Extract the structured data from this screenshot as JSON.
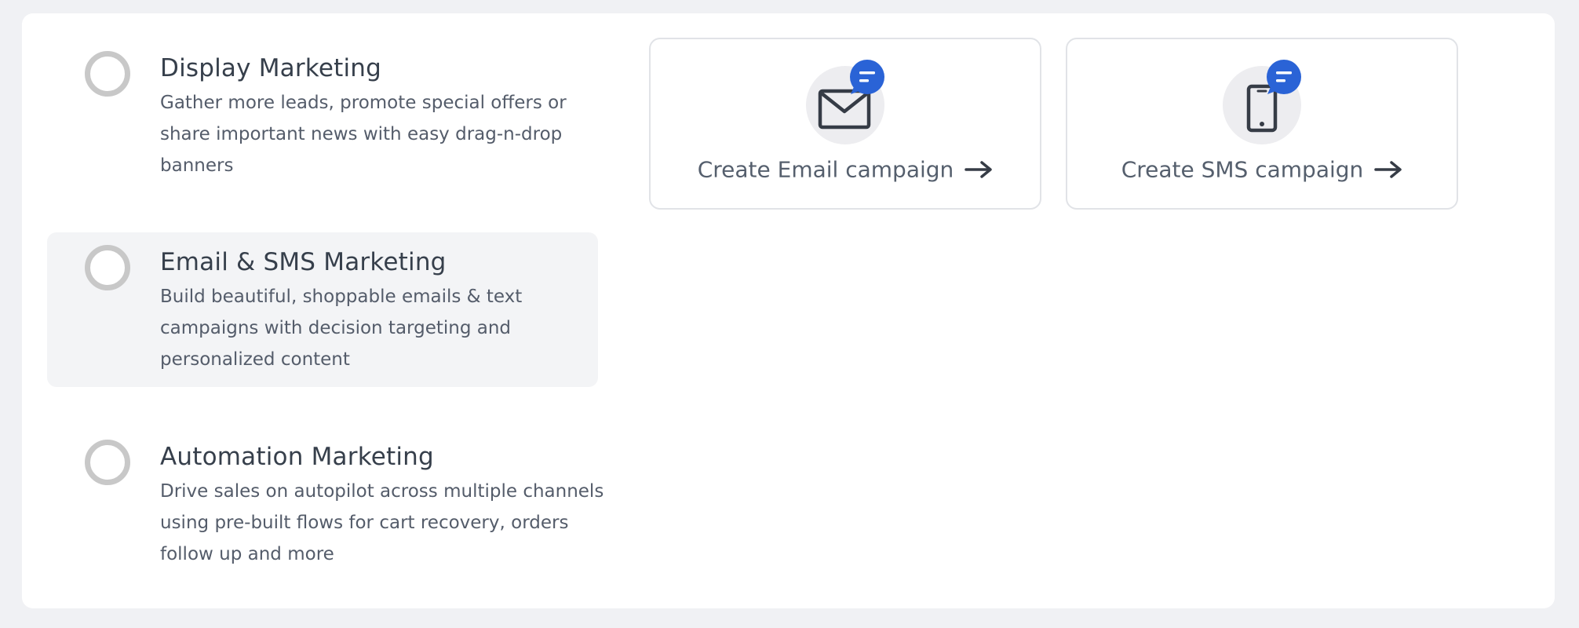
{
  "options": [
    {
      "title": "Display Marketing",
      "description": "Gather more leads, promote special offers or share important news with easy drag-n-drop banners",
      "selected": false
    },
    {
      "title": "Email & SMS Marketing",
      "description": "Build beautiful, shoppable emails & text campaigns with decision targeting and personalized content",
      "selected": false,
      "highlighted": true
    },
    {
      "title": "Automation Marketing",
      "description": "Drive sales on autopilot across multiple channels using pre-built flows for cart recovery, orders follow up and more",
      "selected": false
    }
  ],
  "cards": [
    {
      "label": "Create Email campaign",
      "icon": "envelope-icon",
      "badge_icon": "chat-bubble-icon"
    },
    {
      "label": "Create SMS campaign",
      "icon": "smartphone-icon",
      "badge_icon": "chat-bubble-icon"
    }
  ],
  "colors": {
    "accent": "#2a63d6",
    "icon_dark": "#363c46",
    "radio_border": "#c8c8c8",
    "highlight_bg": "#f3f4f6",
    "page_bg": "#f0f1f4"
  }
}
